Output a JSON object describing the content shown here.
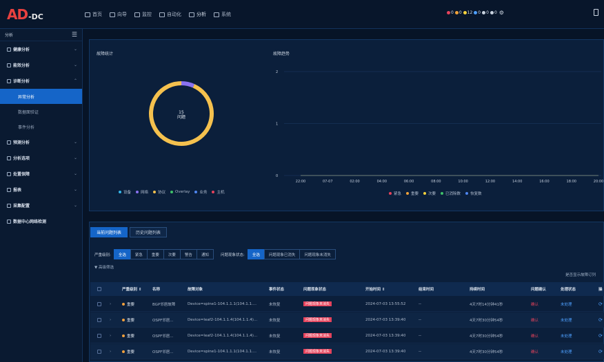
{
  "app": {
    "logo_main": "AD",
    "logo_sub": "-DC"
  },
  "nav": [
    {
      "label": "首页",
      "icon": "home-icon"
    },
    {
      "label": "向导",
      "icon": "guide-icon"
    },
    {
      "label": "监控",
      "icon": "monitor-icon"
    },
    {
      "label": "自动化",
      "icon": "automation-icon"
    },
    {
      "label": "分析",
      "icon": "analysis-icon",
      "active": true
    },
    {
      "label": "系统",
      "icon": "system-icon"
    }
  ],
  "alerts": [
    {
      "count": "0",
      "color": "#e6435c"
    },
    {
      "count": "0",
      "color": "#f0a23a"
    },
    {
      "count": "12",
      "color": "#f5d23c"
    },
    {
      "count": "0",
      "color": "#4ea0ff"
    },
    {
      "count": "0",
      "color": "#c8d2df"
    },
    {
      "count": "0",
      "color": "#c8d2df"
    }
  ],
  "sidebar": {
    "title": "分析",
    "items": [
      {
        "label": "健康分析",
        "chev": "⌄"
      },
      {
        "label": "能效分析",
        "chev": "⌄"
      },
      {
        "label": "诊断分析",
        "chev": "⌃"
      }
    ],
    "sub": [
      {
        "label": "异常分析",
        "active": true
      },
      {
        "label": "数据面验证"
      },
      {
        "label": "事件分析"
      }
    ],
    "items2": [
      {
        "label": "预测分析",
        "chev": "⌄"
      },
      {
        "label": "分析选项",
        "chev": "⌄"
      },
      {
        "label": "处置保障",
        "chev": "⌄"
      },
      {
        "label": "报表",
        "chev": "⌄"
      },
      {
        "label": "采集配置",
        "chev": "⌄"
      },
      {
        "label": "数据中心网络检测",
        "chev": ""
      }
    ]
  },
  "fault_stats": {
    "title": "故障统计",
    "center_value": "15",
    "center_label": "问题",
    "legend": [
      {
        "label": "设备",
        "color": "#35b6e8"
      },
      {
        "label": "网络",
        "color": "#8a72f0"
      },
      {
        "label": "协议",
        "color": "#f5c14e"
      },
      {
        "label": "Overlay",
        "color": "#3fc06a"
      },
      {
        "label": "业务",
        "color": "#4e86f0"
      },
      {
        "label": "主机",
        "color": "#e6435c"
      }
    ],
    "slices": [
      {
        "label": "协议",
        "value": 14,
        "color": "#f5c14e"
      },
      {
        "label": "网络",
        "value": 1,
        "color": "#8a72f0"
      }
    ]
  },
  "chart_data": {
    "type": "line",
    "title": "故障趋势",
    "x": [
      "22:00",
      "07-07",
      "02:00",
      "04:00",
      "06:00",
      "08:00",
      "10:00",
      "12:00",
      "14:00",
      "16:00",
      "18:00",
      "20:00"
    ],
    "ylim": [
      0,
      2
    ],
    "yticks": [
      "0",
      "1",
      "2"
    ],
    "series": [
      {
        "name": "紧急",
        "color": "#e6435c",
        "values": [
          0,
          0,
          0,
          0,
          0,
          0,
          0,
          0,
          0,
          0,
          0,
          0
        ]
      },
      {
        "name": "重要",
        "color": "#f0a23a",
        "values": [
          0,
          0,
          0,
          0,
          0,
          0,
          0,
          0,
          0,
          0,
          0,
          0
        ]
      },
      {
        "name": "次要",
        "color": "#f5d23c",
        "values": [
          0,
          0,
          0,
          0,
          0,
          0,
          0,
          0,
          0,
          0,
          0,
          0
        ]
      },
      {
        "name": "已消除数",
        "color": "#3fc06a",
        "values": [
          0,
          0,
          0,
          0,
          0,
          0,
          0,
          0,
          0,
          0,
          0,
          0
        ]
      },
      {
        "name": "恢复数",
        "color": "#4e86f0",
        "values": [
          0,
          0,
          0,
          0,
          0,
          0,
          0,
          0,
          0,
          0,
          0,
          0
        ]
      }
    ]
  },
  "tabs": [
    {
      "label": "当前问题列表",
      "active": true
    },
    {
      "label": "历史问题列表"
    }
  ],
  "filters": {
    "severity_label": "严重级别:",
    "severity_options": [
      {
        "label": "全选",
        "active": true
      },
      {
        "label": "紧急"
      },
      {
        "label": "重要"
      },
      {
        "label": "次要"
      },
      {
        "label": "警告"
      },
      {
        "label": "通知"
      }
    ],
    "phenomenon_label": "问题现象状态:",
    "phenomenon_options": [
      {
        "label": "全选",
        "active": true
      },
      {
        "label": "问题现象已消失"
      },
      {
        "label": "问题现象未消失"
      }
    ],
    "advanced": "▼ 高级筛选",
    "show_tip": "是否显示故障订列"
  },
  "table": {
    "headers": [
      "严重级别 ⇕",
      "名称",
      "故障对象",
      "事件状态",
      "问题现象状态",
      "开始时间 ⇕",
      "结束时间",
      "持续时间",
      "问题确认",
      "处理状态",
      "操"
    ],
    "rows": [
      {
        "severity": "重要",
        "name": "BGP邻居故障",
        "object": "Device=spine1-104.1.1.1(104.1.1....",
        "event": "未恢复",
        "phenomenon": "问题现象未消失",
        "start": "2024-07-03 13:55:52",
        "end": "--",
        "duration": "4天7时14分钟41秒",
        "confirm": "确认",
        "status": "未处理"
      },
      {
        "severity": "重要",
        "name": "OSPF邻居...",
        "object": "Device=leaf2-104.1.1.4(104.1.1.4)...",
        "event": "未恢复",
        "phenomenon": "问题现象未消失",
        "start": "2024-07-03 13:39:40",
        "end": "--",
        "duration": "4天7时30分钟54秒",
        "confirm": "确认",
        "status": "未处理"
      },
      {
        "severity": "重要",
        "name": "OSPF邻居...",
        "object": "Device=leaf2-104.1.1.4(104.1.1.4)...",
        "event": "未恢复",
        "phenomenon": "问题现象未消失",
        "start": "2024-07-03 13:39:40",
        "end": "--",
        "duration": "4天7时30分钟54秒",
        "confirm": "确认",
        "status": "未处理"
      },
      {
        "severity": "重要",
        "name": "OSPF邻居...",
        "object": "Device=spine1-104.1.1.1(104.1.1....",
        "event": "未恢复",
        "phenomenon": "问题现象未消失",
        "start": "2024-07-03 13:39:40",
        "end": "--",
        "duration": "4天7时30分钟54秒",
        "confirm": "确认",
        "status": "未处理"
      }
    ]
  }
}
